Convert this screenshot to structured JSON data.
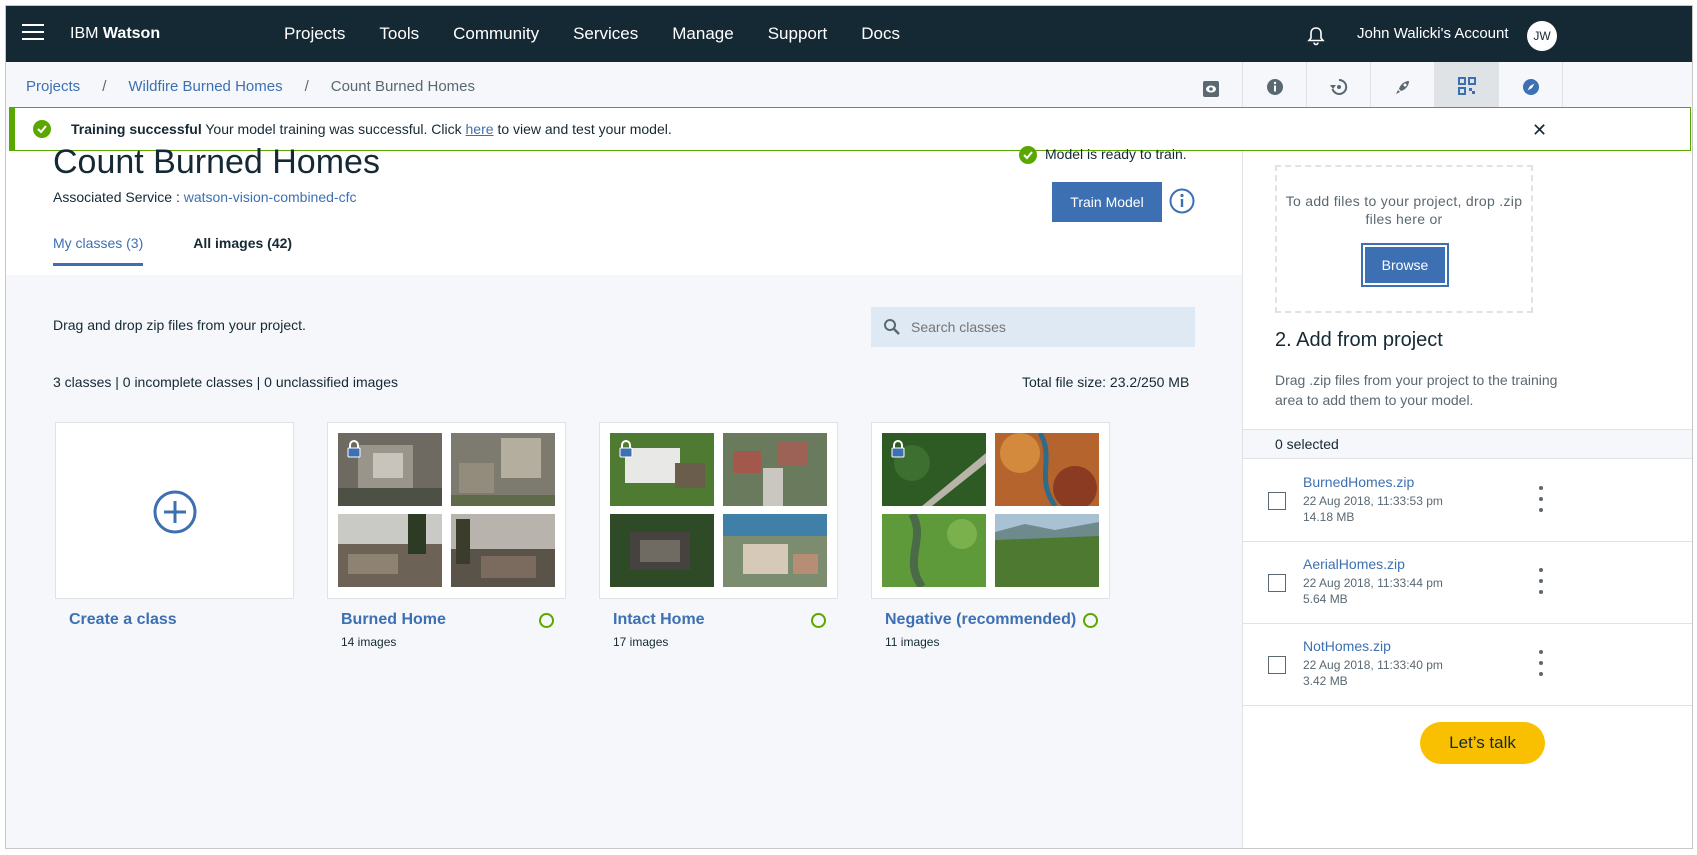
{
  "topnav": {
    "brand_prefix": "IBM",
    "brand_name": "Watson",
    "items": [
      "Projects",
      "Tools",
      "Community",
      "Services",
      "Manage",
      "Support",
      "Docs"
    ],
    "account": "John Walicki's Account",
    "avatar_initials": "JW"
  },
  "breadcrumb": {
    "items": [
      "Projects",
      "Wildfire Burned Homes"
    ],
    "current": "Count Burned Homes",
    "separator": "/"
  },
  "banner": {
    "title": "Training successful",
    "message_pre": "Your model training was successful. Click",
    "link": "here",
    "message_post": "to view and test your model.",
    "close": "✕"
  },
  "page": {
    "title": "Count Burned Homes",
    "assoc_label": "Associated Service :",
    "assoc_service": "watson-vision-combined-cfc",
    "ready_status": "Model is ready to train.",
    "train_button": "Train Model",
    "tabs": [
      "My classes (3)",
      "All images (42)"
    ],
    "dragdrop_text": "Drag and drop zip files from your project.",
    "search_placeholder": "Search classes",
    "stats": "3 classes | 0 incomplete classes | 0 unclassified images",
    "filesize": "Total file size: 23.2/250 MB"
  },
  "classes": [
    {
      "title": "Create a class"
    },
    {
      "title": "Burned Home",
      "count": "14 images"
    },
    {
      "title": "Intact Home",
      "count": "17 images"
    },
    {
      "title": "Negative (recommended)",
      "count": "11 images"
    }
  ],
  "rpanel": {
    "dropzone_text": "To add files to your project, drop .zip files here or",
    "browse_button": "Browse",
    "heading": "2. Add from project",
    "desc": "Drag .zip files from your project to the training area to add them to your model.",
    "selected": "0 selected",
    "files": [
      {
        "name": "BurnedHomes.zip",
        "date": "22 Aug 2018, 11:33:53 pm",
        "size": "14.18 MB"
      },
      {
        "name": "AerialHomes.zip",
        "date": "22 Aug 2018, 11:33:44 pm",
        "size": "5.64 MB"
      },
      {
        "name": "NotHomes.zip",
        "date": "22 Aug 2018, 11:33:40 pm",
        "size": "3.42 MB"
      }
    ]
  },
  "chat_button": "Let’s talk",
  "colors": {
    "nav_bg": "#152935",
    "accent": "#3d70b2",
    "success": "#5aa700",
    "chat": "#f8c000"
  }
}
